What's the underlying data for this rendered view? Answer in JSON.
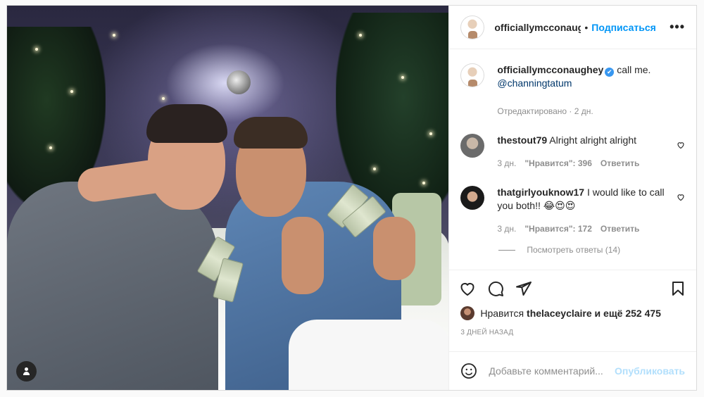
{
  "header": {
    "username": "officiallymcconaug",
    "separator": "•",
    "follow_label": "Подписаться",
    "more_label": "•••"
  },
  "caption": {
    "username": "officiallymcconaughey",
    "verified_icon": "✔",
    "text": "call me.",
    "mention": "@channingtatum",
    "edited": "Отредактировано · 2 дн."
  },
  "comments": [
    {
      "username": "thestout79",
      "text": "Alright alright alright",
      "time": "3 дн.",
      "likes": "\"Нравится\": 396",
      "reply_label": "Ответить"
    },
    {
      "username": "thatgirlyouknow17",
      "text": "I would like to call you both!! 😂😍😍",
      "time": "3 дн.",
      "likes": "\"Нравится\": 172",
      "reply_label": "Ответить"
    }
  ],
  "view_replies": "Посмотреть ответы (14)",
  "likes_bar": {
    "prefix": "Нравится",
    "user": "thelaceyclaire",
    "suffix": "и ещё 252 475"
  },
  "date_label": "3 ДНЕЙ НАЗАД",
  "add_comment": {
    "placeholder": "Добавьте комментарий...",
    "post_label": "Опубликовать"
  },
  "colors": {
    "accent": "#0095f6",
    "muted": "#8e8e8e",
    "verified": "#3897f0"
  }
}
